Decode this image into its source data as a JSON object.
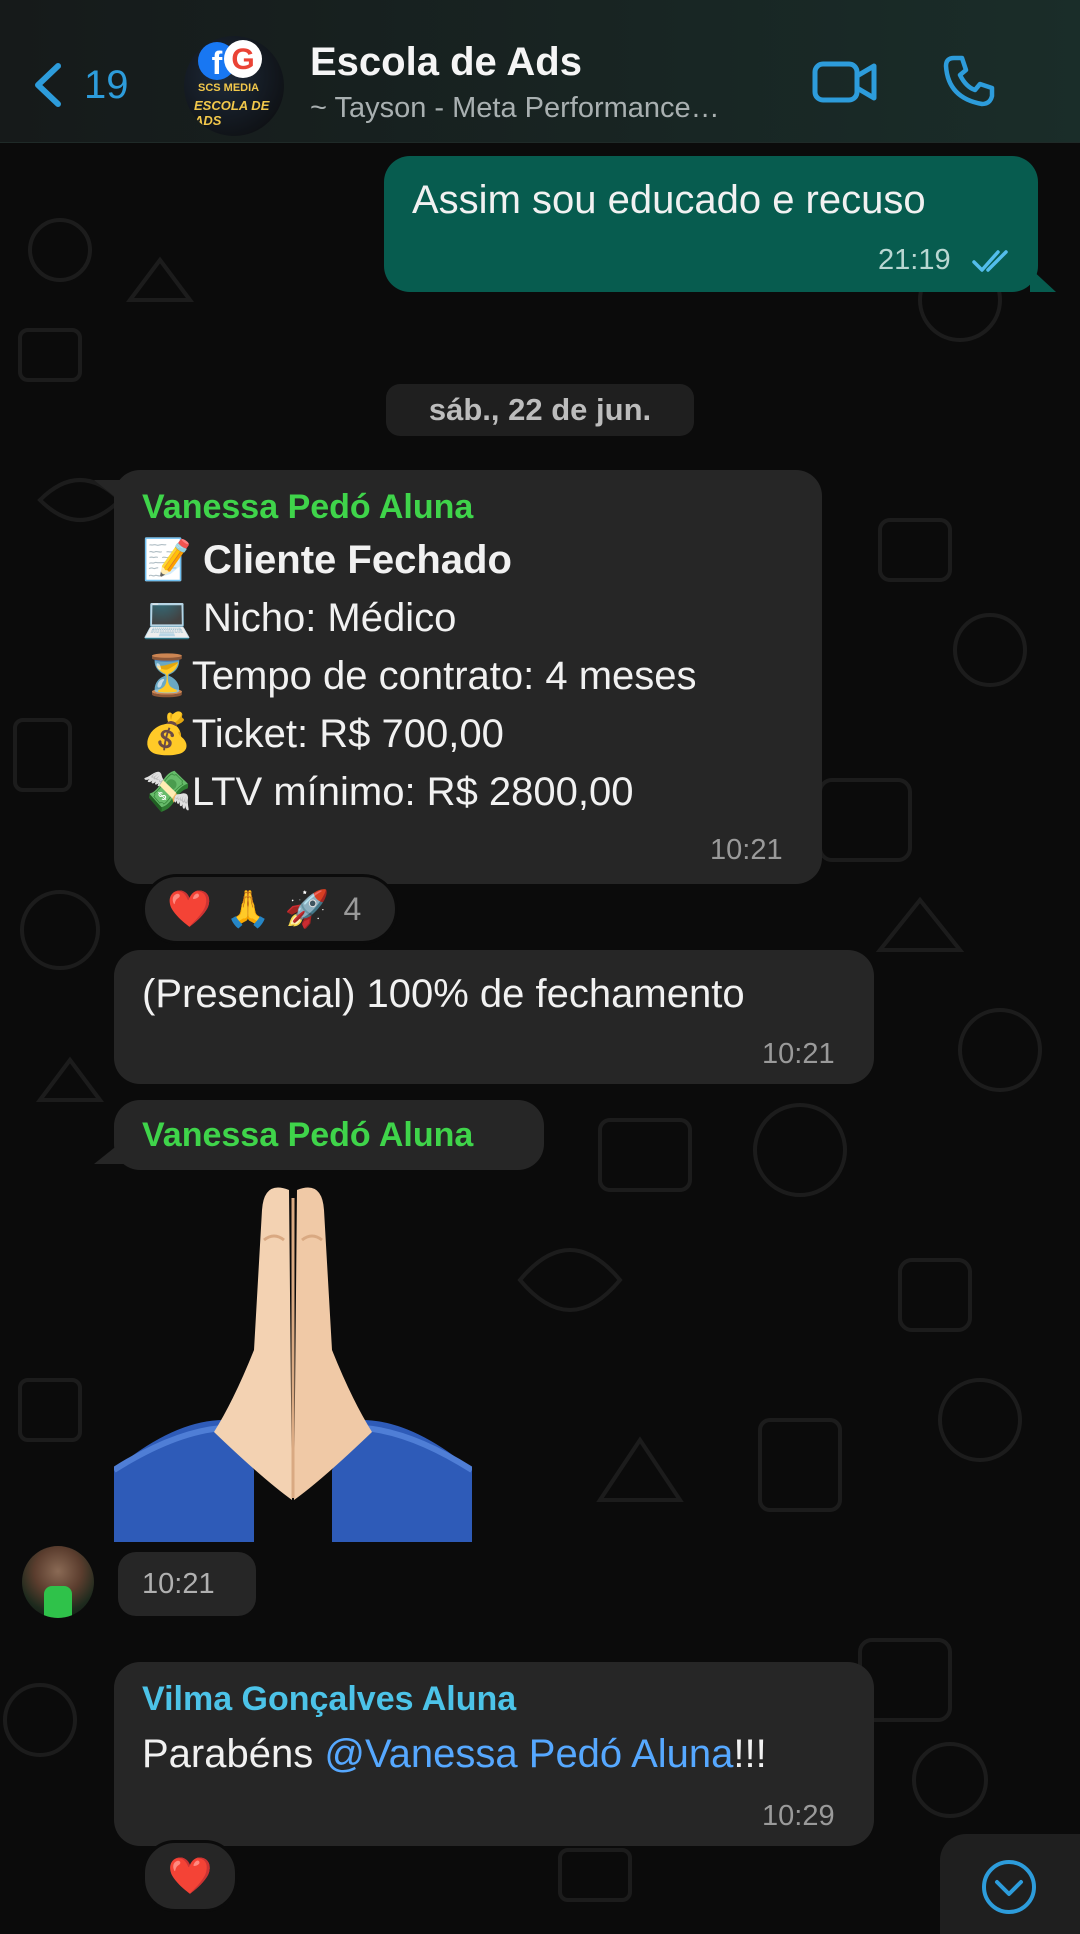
{
  "header": {
    "back_count": "19",
    "title": "Escola de Ads",
    "subtitle": "~ Tayson - Meta Performance…",
    "avatar_brand_line1": "SCS MEDIA",
    "avatar_brand_line2": "ESCOLA DE ADS",
    "accent": "#2d9cdb"
  },
  "messages": {
    "m1": {
      "text": "Assim sou educado e recuso",
      "time": "21:19"
    },
    "date_separator": "sáb., 22 de jun.",
    "m2": {
      "sender": "Vanessa Pedó Aluna",
      "line1_emoji": "📝",
      "line1": "Cliente Fechado",
      "line2_emoji": "💻",
      "line2": "Nicho: Médico",
      "line3_emoji": "⏳",
      "line3": "Tempo de contrato: 4 meses",
      "line4_emoji": "💰",
      "line4": "Ticket: R$ 700,00",
      "line5_emoji": "💸",
      "line5": "LTV mínimo: R$ 2800,00",
      "time": "10:21"
    },
    "m2_reactions": {
      "r1": "❤️",
      "r2": "🙏",
      "r3": "🚀",
      "count": "4"
    },
    "m3": {
      "text": "(Presencial) 100% de fechamento",
      "time": "10:21"
    },
    "m4": {
      "sender": "Vanessa Pedó Aluna",
      "sticker": "praying-hands",
      "time": "10:21"
    },
    "m5": {
      "sender": "Vilma Gonçalves Aluna",
      "text_prefix": "Parabéns ",
      "mention": "@Vanessa Pedó Aluna",
      "text_suffix": "!!!",
      "time": "10:29"
    },
    "m5_reactions": {
      "r1": "❤️"
    }
  },
  "colors": {
    "outgoing_bubble": "#075c4f",
    "incoming_bubble": "#262626",
    "sender_green": "#3fd44a",
    "sender_blue": "#4cc3e8",
    "read_ticks": "#53bdeb"
  }
}
